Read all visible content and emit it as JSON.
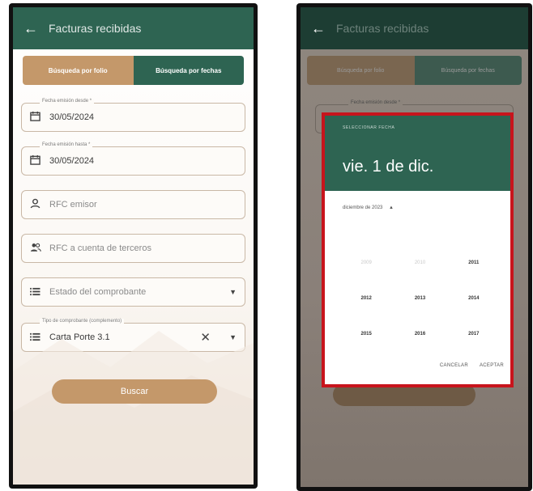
{
  "left": {
    "appbar": {
      "back": "←",
      "title": "Facturas recibidas"
    },
    "tabs": [
      {
        "label": "Búsqueda por folio"
      },
      {
        "label": "Búsqueda por fechas"
      }
    ],
    "fields": [
      {
        "label": "Fecha emisión desde *",
        "value": "30/05/2024",
        "icon": "calendar-icon"
      },
      {
        "label": "Fecha emisión hasta *",
        "value": "30/05/2024",
        "icon": "calendar-icon"
      },
      {
        "placeholder": "RFC emisor",
        "icon": "person-icon"
      },
      {
        "placeholder": "RFC a cuenta de terceros",
        "icon": "people-icon"
      },
      {
        "placeholder": "Estado del comprobante",
        "icon": "list-icon"
      },
      {
        "label": "Tipo de comprobante (complemento)",
        "value": "Carta Porte 3.1",
        "icon": "list-icon",
        "clear": "✕"
      }
    ],
    "dropdown_glyph": "▼",
    "search_button": "Buscar"
  },
  "right": {
    "appbar": {
      "back": "←",
      "title": "Facturas recibidas"
    },
    "tabs": [
      {
        "label": "Búsqueda por folio"
      },
      {
        "label": "Búsqueda por fechas"
      }
    ],
    "field_label": "Fecha emisión desde *",
    "dialog": {
      "header_label": "SELECCIONAR FECHA",
      "selected_date": "vie. 1 de dic.",
      "month_selector": "diciembre de 2023",
      "month_caret": "▲",
      "years": [
        [
          "2009",
          "2010",
          "2011"
        ],
        [
          "2012",
          "2013",
          "2014"
        ],
        [
          "2015",
          "2016",
          "2017"
        ]
      ],
      "disabled_years": [
        "2009",
        "2010"
      ],
      "cancel": "CANCELAR",
      "accept": "ACEPTAR"
    }
  },
  "colors": {
    "primary": "#2e6452",
    "accent": "#c4986a",
    "highlight": "#c8141c"
  }
}
